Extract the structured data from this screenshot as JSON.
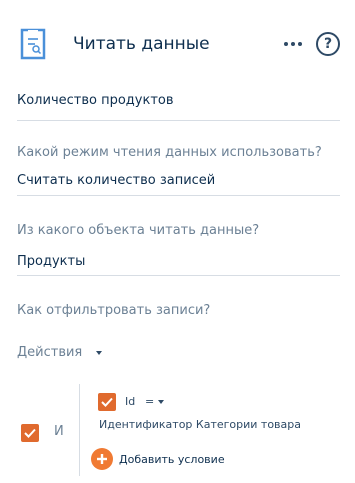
{
  "header": {
    "title": "Читать данные",
    "icon": "filter-list-icon",
    "more_icon": "more-icon",
    "help_icon": "help-icon",
    "help_symbol": "?"
  },
  "fields": {
    "name_value": "Количество продуктов",
    "mode_question": "Какой режим чтения данных использовать?",
    "mode_value": "Считать количество записей",
    "object_question": "Из какого объекта читать данные?",
    "object_value": "Продукты",
    "filter_question": "Как отфильтровать записи?"
  },
  "filter": {
    "actions_label": "Действия",
    "group_operator": "И",
    "group_checked": true,
    "condition": {
      "checked": true,
      "field": "Id",
      "operator": "=",
      "value": "Идентификатор Категории товара"
    },
    "add_condition_label": "Добавить условие"
  },
  "colors": {
    "accent": "#e06a2e",
    "add_button": "#f07a33",
    "icon_blue": "#4a90d9",
    "text": "#0d2e4e",
    "muted": "#6c8195"
  }
}
